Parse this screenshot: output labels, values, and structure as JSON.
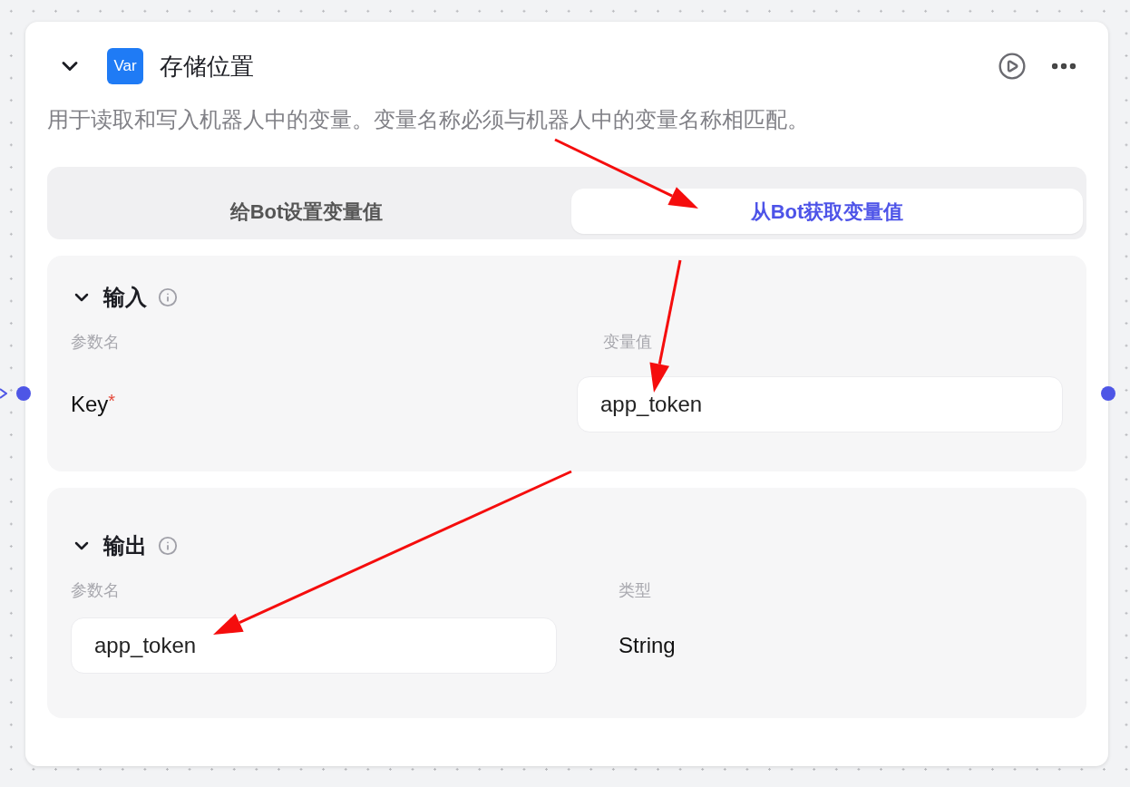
{
  "node": {
    "icon_label": "Var",
    "title": "存储位置",
    "description": "用于读取和写入机器人中的变量。变量名称必须与机器人中的变量名称相匹配。",
    "tabs": [
      {
        "label": "给Bot设置变量值",
        "selected": false
      },
      {
        "label": "从Bot获取变量值",
        "selected": true
      }
    ],
    "sections": [
      {
        "kind": "input",
        "title": "输入",
        "expanded": true,
        "columns": [
          "参数名",
          "变量值"
        ],
        "name": "Key",
        "required_mark": "*",
        "value": "app_token"
      },
      {
        "kind": "output",
        "title": "输出",
        "expanded": true,
        "columns": [
          "参数名",
          "类型"
        ],
        "name": "app_token",
        "value": "String"
      }
    ]
  }
}
